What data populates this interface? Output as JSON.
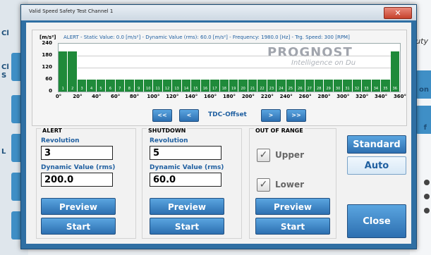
{
  "background": {
    "left_labels": [
      "Cl",
      "Cl",
      "S",
      "L"
    ],
    "right_labels": [
      "uty",
      "on",
      "f"
    ]
  },
  "window": {
    "title": "Valid Speed Safety Test Channel 1",
    "close_glyph": "✕"
  },
  "chart": {
    "unit_label": "[m/s²]",
    "status_line": "ALERT -  Static Value: 0.0 [m/s²]  -  Dynamic Value (rms): 60.0 [m/s²]  -  Frequency: 1980.0 [Hz]  -  Trg. Speed: 300 [RPM]",
    "logo_text": "PROGNOST",
    "logo_tagline": "Intelligence on Du"
  },
  "chart_data": {
    "type": "bar",
    "ylabel": "[m/s²]",
    "ylim": [
      0,
      240
    ],
    "yticks": [
      "240",
      "180",
      "120",
      "60",
      "0"
    ],
    "xticks": [
      "0°",
      "20°",
      "40°",
      "60°",
      "80°",
      "100°",
      "120°",
      "140°",
      "160°",
      "180°",
      "200°",
      "220°",
      "240°",
      "260°",
      "280°",
      "300°",
      "320°",
      "340°",
      "360°"
    ],
    "categories": [
      "1",
      "2",
      "3",
      "4",
      "5",
      "6",
      "7",
      "8",
      "9",
      "10",
      "11",
      "12",
      "13",
      "14",
      "15",
      "16",
      "17",
      "18",
      "19",
      "20",
      "21",
      "22",
      "23",
      "24",
      "25",
      "26",
      "27",
      "28",
      "29",
      "30",
      "31",
      "32",
      "33",
      "34",
      "35",
      "36"
    ],
    "values": [
      200,
      200,
      60,
      60,
      60,
      60,
      60,
      60,
      60,
      60,
      60,
      60,
      60,
      60,
      60,
      60,
      60,
      60,
      60,
      60,
      60,
      60,
      60,
      60,
      60,
      60,
      60,
      60,
      60,
      60,
      60,
      60,
      60,
      60,
      60,
      200
    ],
    "bar_color": "#1f8a3a",
    "grid": true
  },
  "nav": {
    "first": "<<",
    "prev": "<",
    "label": "TDC-Offset",
    "next": ">",
    "last": ">>"
  },
  "alert": {
    "group_label": "ALERT",
    "revolution_label": "Revolution",
    "revolution_value": "3",
    "dynamic_label": "Dynamic Value (rms)",
    "dynamic_value": "200.0",
    "preview": "Preview",
    "start": "Start"
  },
  "shutdown": {
    "group_label": "SHUTDOWN",
    "revolution_label": "Revolution",
    "revolution_value": "5",
    "dynamic_label": "Dynamic Value (rms)",
    "dynamic_value": "60.0",
    "preview": "Preview",
    "start": "Start"
  },
  "out_of_range": {
    "group_label": "OUT OF RANGE",
    "upper_label": "Upper",
    "upper_checked": true,
    "lower_label": "Lower",
    "lower_checked": true,
    "check_glyph": "✓",
    "preview": "Preview",
    "start": "Start"
  },
  "right_buttons": {
    "standard": "Standard",
    "auto": "Auto",
    "close": "Close"
  }
}
